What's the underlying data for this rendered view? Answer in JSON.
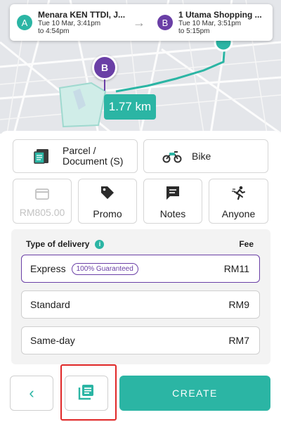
{
  "route": {
    "pickup": {
      "badge": "A",
      "name": "Menara KEN TTDI, J...",
      "time": "Tue 10 Mar, 3:41pm",
      "until": "to 4:54pm"
    },
    "dropoff": {
      "badge": "B",
      "name": "1 Utama Shopping ...",
      "time": "Tue 10 Mar, 3:51pm",
      "until": "to 5:15pm"
    },
    "arrow": "→"
  },
  "map": {
    "pin_label": "B",
    "distance": "1.77 km"
  },
  "item_type": {
    "label": "Parcel / Document (S)",
    "icon": "parcel-document-icon"
  },
  "vehicle": {
    "label": "Bike",
    "icon": "motorbike-icon"
  },
  "options": {
    "payment": {
      "label": "RM805.00",
      "icon": "credit-card-icon"
    },
    "promo": {
      "label": "Promo",
      "icon": "tag-icon"
    },
    "notes": {
      "label": "Notes",
      "icon": "note-icon"
    },
    "recipient": {
      "label": "Anyone",
      "icon": "running-person-icon"
    }
  },
  "delivery": {
    "header": "Type of delivery",
    "fee_header": "Fee",
    "info_icon": "i",
    "types": [
      {
        "name": "Express",
        "badge": "100% Guaranteed",
        "fee": "RM11",
        "selected": true
      },
      {
        "name": "Standard",
        "fee": "RM9",
        "selected": false
      },
      {
        "name": "Same-day",
        "fee": "RM7",
        "selected": false
      }
    ]
  },
  "footer": {
    "back_symbol": "‹",
    "create_label": "CREATE"
  },
  "colors": {
    "accent": "#2bb5a4",
    "purple": "#6a3fa6",
    "highlight": "#e02828"
  }
}
